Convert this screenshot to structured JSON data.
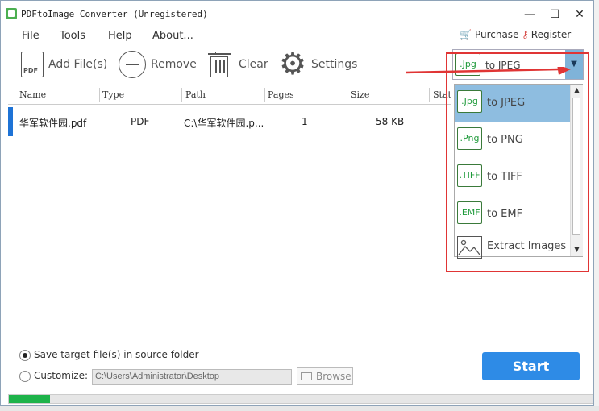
{
  "window": {
    "title": "PDFtoImage Converter (Unregistered)",
    "minimize": "—",
    "maximize": "☐",
    "close": "✕"
  },
  "menu": [
    "File",
    "Tools",
    "Help",
    "About..."
  ],
  "header_links": {
    "purchase": "Purchase",
    "register": "Register"
  },
  "toolbar": {
    "add_files": "Add File(s)",
    "remove": "Remove",
    "clear": "Clear",
    "settings": "Settings"
  },
  "format_select": {
    "badge": ".Jpg",
    "label": "to JPEG"
  },
  "table": {
    "headers": [
      "Name",
      "Type",
      "Path",
      "Pages",
      "Size",
      "Stat"
    ],
    "rows": [
      {
        "name": "华军软件园.pdf",
        "type": "PDF",
        "path": "C:\\华军软件园.p...",
        "pages": "1",
        "size": "58 KB"
      }
    ]
  },
  "dropdown": {
    "items": [
      {
        "badge": ".Jpg",
        "label": "to JPEG",
        "selected": true
      },
      {
        "badge": ".Png",
        "label": "to PNG"
      },
      {
        "badge": ".TIFF",
        "label": "to TIFF"
      },
      {
        "badge": ".EMF",
        "label": "to EMF"
      },
      {
        "badge": "",
        "label": "Extract Images"
      }
    ]
  },
  "output": {
    "source_folder_label": "Save target file(s) in source folder",
    "customize_label": "Customize:",
    "path_value": "C:\\Users\\Administrator\\Desktop",
    "browse": "Browse"
  },
  "start": "Start",
  "progress": 0.07,
  "colors": {
    "accent": "#2e8be6",
    "highlight": "#e03535",
    "progress": "#1db34a",
    "selection": "#8ebde0"
  }
}
